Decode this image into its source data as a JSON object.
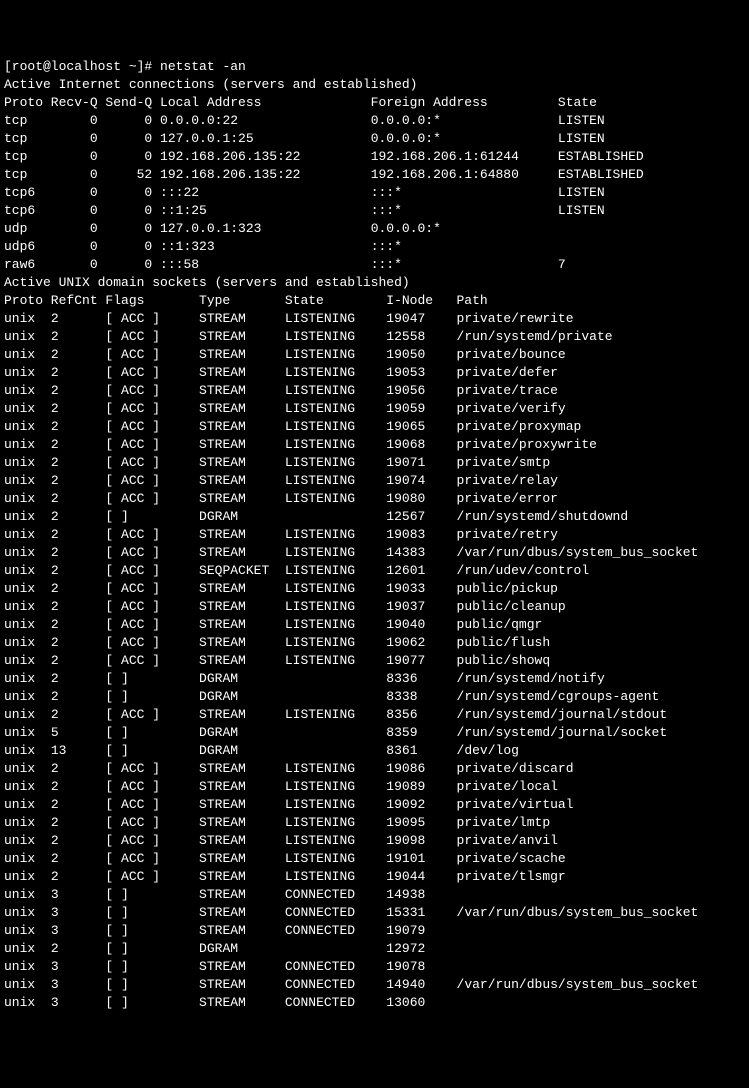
{
  "prompt": "[root@localhost ~]# ",
  "command": "netstat -an",
  "header_inet": "Active Internet connections (servers and established)",
  "cols_inet": {
    "proto": "Proto",
    "recvq": "Recv-Q",
    "sendq": "Send-Q",
    "local": "Local Address",
    "foreign": "Foreign Address",
    "state": "State"
  },
  "inet": [
    {
      "proto": "tcp",
      "recvq": "0",
      "sendq": "0",
      "local": "0.0.0.0:22",
      "foreign": "0.0.0.0:*",
      "state": "LISTEN"
    },
    {
      "proto": "tcp",
      "recvq": "0",
      "sendq": "0",
      "local": "127.0.0.1:25",
      "foreign": "0.0.0.0:*",
      "state": "LISTEN"
    },
    {
      "proto": "tcp",
      "recvq": "0",
      "sendq": "0",
      "local": "192.168.206.135:22",
      "foreign": "192.168.206.1:61244",
      "state": "ESTABLISHED"
    },
    {
      "proto": "tcp",
      "recvq": "0",
      "sendq": "52",
      "local": "192.168.206.135:22",
      "foreign": "192.168.206.1:64880",
      "state": "ESTABLISHED"
    },
    {
      "proto": "tcp6",
      "recvq": "0",
      "sendq": "0",
      "local": ":::22",
      "foreign": ":::*",
      "state": "LISTEN"
    },
    {
      "proto": "tcp6",
      "recvq": "0",
      "sendq": "0",
      "local": "::1:25",
      "foreign": ":::*",
      "state": "LISTEN"
    },
    {
      "proto": "udp",
      "recvq": "0",
      "sendq": "0",
      "local": "127.0.0.1:323",
      "foreign": "0.0.0.0:*",
      "state": ""
    },
    {
      "proto": "udp6",
      "recvq": "0",
      "sendq": "0",
      "local": "::1:323",
      "foreign": ":::*",
      "state": ""
    },
    {
      "proto": "raw6",
      "recvq": "0",
      "sendq": "0",
      "local": ":::58",
      "foreign": ":::*",
      "state": "7"
    }
  ],
  "header_unix": "Active UNIX domain sockets (servers and established)",
  "cols_unix": {
    "proto": "Proto",
    "refcnt": "RefCnt",
    "flags": "Flags",
    "type": "Type",
    "state": "State",
    "inode": "I-Node",
    "path": "Path"
  },
  "unix": [
    {
      "proto": "unix",
      "refcnt": "2",
      "flags": "[ ACC ]",
      "type": "STREAM",
      "state": "LISTENING",
      "inode": "19047",
      "path": "private/rewrite"
    },
    {
      "proto": "unix",
      "refcnt": "2",
      "flags": "[ ACC ]",
      "type": "STREAM",
      "state": "LISTENING",
      "inode": "12558",
      "path": "/run/systemd/private"
    },
    {
      "proto": "unix",
      "refcnt": "2",
      "flags": "[ ACC ]",
      "type": "STREAM",
      "state": "LISTENING",
      "inode": "19050",
      "path": "private/bounce"
    },
    {
      "proto": "unix",
      "refcnt": "2",
      "flags": "[ ACC ]",
      "type": "STREAM",
      "state": "LISTENING",
      "inode": "19053",
      "path": "private/defer"
    },
    {
      "proto": "unix",
      "refcnt": "2",
      "flags": "[ ACC ]",
      "type": "STREAM",
      "state": "LISTENING",
      "inode": "19056",
      "path": "private/trace"
    },
    {
      "proto": "unix",
      "refcnt": "2",
      "flags": "[ ACC ]",
      "type": "STREAM",
      "state": "LISTENING",
      "inode": "19059",
      "path": "private/verify"
    },
    {
      "proto": "unix",
      "refcnt": "2",
      "flags": "[ ACC ]",
      "type": "STREAM",
      "state": "LISTENING",
      "inode": "19065",
      "path": "private/proxymap"
    },
    {
      "proto": "unix",
      "refcnt": "2",
      "flags": "[ ACC ]",
      "type": "STREAM",
      "state": "LISTENING",
      "inode": "19068",
      "path": "private/proxywrite"
    },
    {
      "proto": "unix",
      "refcnt": "2",
      "flags": "[ ACC ]",
      "type": "STREAM",
      "state": "LISTENING",
      "inode": "19071",
      "path": "private/smtp"
    },
    {
      "proto": "unix",
      "refcnt": "2",
      "flags": "[ ACC ]",
      "type": "STREAM",
      "state": "LISTENING",
      "inode": "19074",
      "path": "private/relay"
    },
    {
      "proto": "unix",
      "refcnt": "2",
      "flags": "[ ACC ]",
      "type": "STREAM",
      "state": "LISTENING",
      "inode": "19080",
      "path": "private/error"
    },
    {
      "proto": "unix",
      "refcnt": "2",
      "flags": "[ ]",
      "type": "DGRAM",
      "state": "",
      "inode": "12567",
      "path": "/run/systemd/shutdownd"
    },
    {
      "proto": "unix",
      "refcnt": "2",
      "flags": "[ ACC ]",
      "type": "STREAM",
      "state": "LISTENING",
      "inode": "19083",
      "path": "private/retry"
    },
    {
      "proto": "unix",
      "refcnt": "2",
      "flags": "[ ACC ]",
      "type": "STREAM",
      "state": "LISTENING",
      "inode": "14383",
      "path": "/var/run/dbus/system_bus_socket"
    },
    {
      "proto": "unix",
      "refcnt": "2",
      "flags": "[ ACC ]",
      "type": "SEQPACKET",
      "state": "LISTENING",
      "inode": "12601",
      "path": "/run/udev/control"
    },
    {
      "proto": "unix",
      "refcnt": "2",
      "flags": "[ ACC ]",
      "type": "STREAM",
      "state": "LISTENING",
      "inode": "19033",
      "path": "public/pickup"
    },
    {
      "proto": "unix",
      "refcnt": "2",
      "flags": "[ ACC ]",
      "type": "STREAM",
      "state": "LISTENING",
      "inode": "19037",
      "path": "public/cleanup"
    },
    {
      "proto": "unix",
      "refcnt": "2",
      "flags": "[ ACC ]",
      "type": "STREAM",
      "state": "LISTENING",
      "inode": "19040",
      "path": "public/qmgr"
    },
    {
      "proto": "unix",
      "refcnt": "2",
      "flags": "[ ACC ]",
      "type": "STREAM",
      "state": "LISTENING",
      "inode": "19062",
      "path": "public/flush"
    },
    {
      "proto": "unix",
      "refcnt": "2",
      "flags": "[ ACC ]",
      "type": "STREAM",
      "state": "LISTENING",
      "inode": "19077",
      "path": "public/showq"
    },
    {
      "proto": "unix",
      "refcnt": "2",
      "flags": "[ ]",
      "type": "DGRAM",
      "state": "",
      "inode": "8336",
      "path": "/run/systemd/notify"
    },
    {
      "proto": "unix",
      "refcnt": "2",
      "flags": "[ ]",
      "type": "DGRAM",
      "state": "",
      "inode": "8338",
      "path": "/run/systemd/cgroups-agent"
    },
    {
      "proto": "unix",
      "refcnt": "2",
      "flags": "[ ACC ]",
      "type": "STREAM",
      "state": "LISTENING",
      "inode": "8356",
      "path": "/run/systemd/journal/stdout"
    },
    {
      "proto": "unix",
      "refcnt": "5",
      "flags": "[ ]",
      "type": "DGRAM",
      "state": "",
      "inode": "8359",
      "path": "/run/systemd/journal/socket"
    },
    {
      "proto": "unix",
      "refcnt": "13",
      "flags": "[ ]",
      "type": "DGRAM",
      "state": "",
      "inode": "8361",
      "path": "/dev/log"
    },
    {
      "proto": "unix",
      "refcnt": "2",
      "flags": "[ ACC ]",
      "type": "STREAM",
      "state": "LISTENING",
      "inode": "19086",
      "path": "private/discard"
    },
    {
      "proto": "unix",
      "refcnt": "2",
      "flags": "[ ACC ]",
      "type": "STREAM",
      "state": "LISTENING",
      "inode": "19089",
      "path": "private/local"
    },
    {
      "proto": "unix",
      "refcnt": "2",
      "flags": "[ ACC ]",
      "type": "STREAM",
      "state": "LISTENING",
      "inode": "19092",
      "path": "private/virtual"
    },
    {
      "proto": "unix",
      "refcnt": "2",
      "flags": "[ ACC ]",
      "type": "STREAM",
      "state": "LISTENING",
      "inode": "19095",
      "path": "private/lmtp"
    },
    {
      "proto": "unix",
      "refcnt": "2",
      "flags": "[ ACC ]",
      "type": "STREAM",
      "state": "LISTENING",
      "inode": "19098",
      "path": "private/anvil"
    },
    {
      "proto": "unix",
      "refcnt": "2",
      "flags": "[ ACC ]",
      "type": "STREAM",
      "state": "LISTENING",
      "inode": "19101",
      "path": "private/scache"
    },
    {
      "proto": "unix",
      "refcnt": "2",
      "flags": "[ ACC ]",
      "type": "STREAM",
      "state": "LISTENING",
      "inode": "19044",
      "path": "private/tlsmgr"
    },
    {
      "proto": "unix",
      "refcnt": "3",
      "flags": "[ ]",
      "type": "STREAM",
      "state": "CONNECTED",
      "inode": "14938",
      "path": ""
    },
    {
      "proto": "unix",
      "refcnt": "3",
      "flags": "[ ]",
      "type": "STREAM",
      "state": "CONNECTED",
      "inode": "15331",
      "path": "/var/run/dbus/system_bus_socket"
    },
    {
      "proto": "unix",
      "refcnt": "3",
      "flags": "[ ]",
      "type": "STREAM",
      "state": "CONNECTED",
      "inode": "19079",
      "path": ""
    },
    {
      "proto": "unix",
      "refcnt": "2",
      "flags": "[ ]",
      "type": "DGRAM",
      "state": "",
      "inode": "12972",
      "path": ""
    },
    {
      "proto": "unix",
      "refcnt": "3",
      "flags": "[ ]",
      "type": "STREAM",
      "state": "CONNECTED",
      "inode": "19078",
      "path": ""
    },
    {
      "proto": "unix",
      "refcnt": "3",
      "flags": "[ ]",
      "type": "STREAM",
      "state": "CONNECTED",
      "inode": "14940",
      "path": "/var/run/dbus/system_bus_socket"
    },
    {
      "proto": "unix",
      "refcnt": "3",
      "flags": "[ ]",
      "type": "STREAM",
      "state": "CONNECTED",
      "inode": "13060",
      "path": ""
    }
  ]
}
